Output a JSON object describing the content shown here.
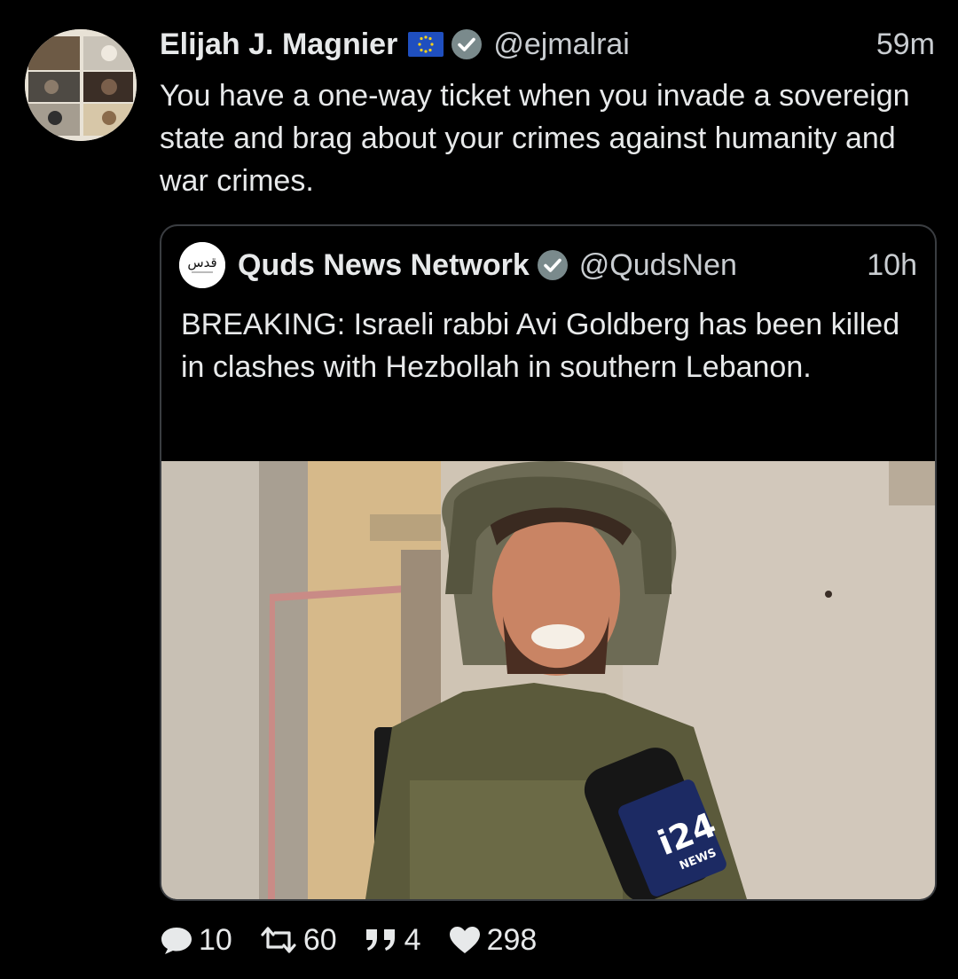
{
  "tweet": {
    "author_name": "Elijah J. Magnier",
    "flag_icon": "eu-flag-icon",
    "verified_icon": "verified-badge-icon",
    "handle": "@ejmalrai",
    "time": "59m",
    "text": "You have a one-way ticket when you invade a sovereign state and brag about your crimes against humanity and war crimes."
  },
  "quoted_tweet": {
    "avatar_text": "قدس",
    "author_name": "Quds News Network",
    "handle": "@QudsNen",
    "time": "10h",
    "text": "BREAKING: Israeli rabbi Avi Goldberg has been killed in clashes with Hezbollah in southern Lebanon.",
    "media": {
      "description_icon": "photo",
      "mic_logo": "i24",
      "mic_logo_sub": "NEWS"
    }
  },
  "actions": {
    "replies": "10",
    "retweets": "60",
    "quotes": "4",
    "likes": "298"
  },
  "colors": {
    "background": "#000000",
    "text": "#e7e9ea",
    "secondary": "#c9cdd1",
    "border": "#3a3d41",
    "verified": "#7a8a8c"
  }
}
